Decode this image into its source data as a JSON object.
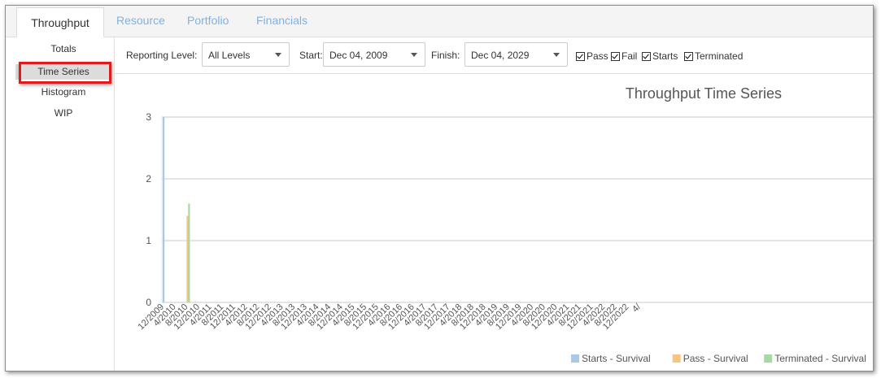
{
  "tabs": [
    {
      "label": "Throughput",
      "active": true
    },
    {
      "label": "Resource",
      "active": false
    },
    {
      "label": "Portfolio",
      "active": false
    },
    {
      "label": "Financials",
      "active": false
    }
  ],
  "sidebar": {
    "items": [
      {
        "label": "Totals",
        "selected": false
      },
      {
        "label": "Time Series",
        "selected": true
      },
      {
        "label": "Histogram",
        "selected": false
      },
      {
        "label": "WIP",
        "selected": false
      }
    ]
  },
  "toolbar": {
    "reporting_level_label": "Reporting Level:",
    "reporting_level_value": "All Levels",
    "start_label": "Start:",
    "start_value": "Dec 04, 2009",
    "finish_label": "Finish:",
    "finish_value": "Dec 04, 2029",
    "checkboxes": [
      {
        "label": "Pass",
        "checked": true
      },
      {
        "label": "Fail",
        "checked": true
      },
      {
        "label": "Starts",
        "checked": true
      },
      {
        "label": "Terminated",
        "checked": true
      }
    ]
  },
  "colors": {
    "accent_tab": "#7cb3e6",
    "highlight": "#e01b1b",
    "starts": "#a9c9e6",
    "pass": "#f7c583",
    "terminated": "#a8d8a3"
  },
  "chart_data": {
    "type": "bar",
    "title": "Throughput Time Series",
    "ylim": [
      0,
      3
    ],
    "yticks": [
      "0",
      "1",
      "2",
      "3"
    ],
    "categories": [
      "12/2009",
      "4/2010",
      "8/2010",
      "12/2010",
      "4/2011",
      "8/2011",
      "12/2011",
      "4/2012",
      "8/2012",
      "12/2012",
      "4/2013",
      "8/2013",
      "12/2013",
      "4/2014",
      "8/2014",
      "12/2014",
      "4/2015",
      "8/2015",
      "12/2015",
      "4/2016",
      "8/2016",
      "12/2016",
      "4/2017",
      "8/2017",
      "12/2017",
      "4/2018",
      "8/2018",
      "12/2018",
      "4/2019",
      "8/2019",
      "12/2019",
      "4/2020",
      "8/2020",
      "12/2020",
      "4/2021",
      "8/2021",
      "12/2021",
      "4/2022",
      "8/2022",
      "12/2022",
      "4/"
    ],
    "series": [
      {
        "name": "Starts - Survival",
        "color": "#a9c9e6",
        "points": [
          {
            "x": "12/2009",
            "y": 3
          }
        ]
      },
      {
        "name": "Pass - Survival",
        "color": "#f7c583",
        "points": [
          {
            "x": "8/2010",
            "y": 1.4
          }
        ]
      },
      {
        "name": "Terminated - Survival",
        "color": "#a8d8a3",
        "points": [
          {
            "x": "8/2010",
            "y": 1.6
          }
        ]
      }
    ],
    "grid": true,
    "legend": "bottom-right"
  }
}
